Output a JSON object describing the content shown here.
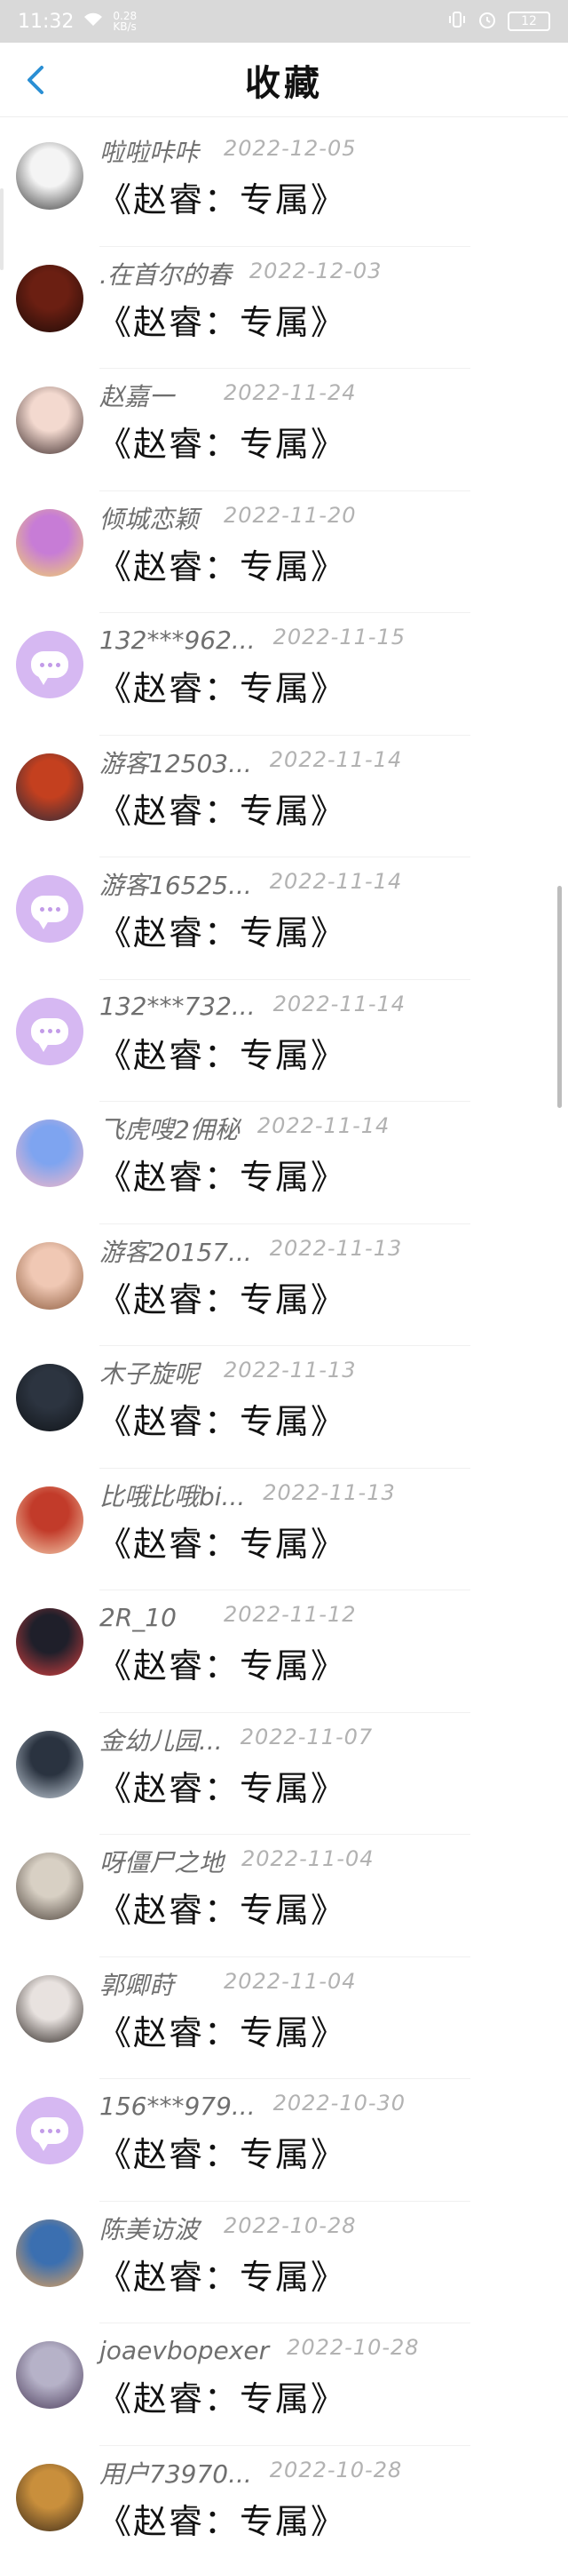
{
  "status_bar": {
    "time": "11:32",
    "network": "0.28 KB/s",
    "battery": "12"
  },
  "header": {
    "title": "收藏"
  },
  "items": [
    {
      "name": "啦啦咔咔",
      "date": "2022-12-05",
      "title": "《赵睿：专属》",
      "avatar": "photo-dog"
    },
    {
      "name": ".在首尔的春",
      "date": "2022-12-03",
      "title": "《赵睿：专属》",
      "avatar": "photo-dark"
    },
    {
      "name": "赵嘉一",
      "date": "2022-11-24",
      "title": "《赵睿：专属》",
      "avatar": "photo-woman"
    },
    {
      "name": "倾城恋颖",
      "date": "2022-11-20",
      "title": "《赵睿：专属》",
      "avatar": "photo-anime"
    },
    {
      "name": "132***962...",
      "date": "2022-11-15",
      "title": "《赵睿：专属》",
      "avatar": "default"
    },
    {
      "name": "游客12503...",
      "date": "2022-11-14",
      "title": "《赵睿：专属》",
      "avatar": "photo-car"
    },
    {
      "name": "游客16525...",
      "date": "2022-11-14",
      "title": "《赵睿：专属》",
      "avatar": "default"
    },
    {
      "name": "132***732...",
      "date": "2022-11-14",
      "title": "《赵睿：专属》",
      "avatar": "default"
    },
    {
      "name": "飞虎嗖2佣秘",
      "date": "2022-11-14",
      "title": "《赵睿：专属》",
      "avatar": "photo-cartoon"
    },
    {
      "name": "游客20157...",
      "date": "2022-11-13",
      "title": "《赵睿：专属》",
      "avatar": "photo-girl"
    },
    {
      "name": "木子旋呢",
      "date": "2022-11-13",
      "title": "《赵睿：专属》",
      "avatar": "photo-car-dark"
    },
    {
      "name": "比哦比哦bi...",
      "date": "2022-11-13",
      "title": "《赵睿：专属》",
      "avatar": "photo-red"
    },
    {
      "name": "2R_10",
      "date": "2022-11-12",
      "title": "《赵睿：专属》",
      "avatar": "photo-player"
    },
    {
      "name": "金幼儿园...",
      "date": "2022-11-07",
      "title": "《赵睿：专属》",
      "avatar": "photo-man"
    },
    {
      "name": "呀僵尸之地",
      "date": "2022-11-04",
      "title": "《赵睿：专属》",
      "avatar": "photo-room"
    },
    {
      "name": "郭卿莳",
      "date": "2022-11-04",
      "title": "《赵睿：专属》",
      "avatar": "photo-girl2"
    },
    {
      "name": "156***979...",
      "date": "2022-10-30",
      "title": "《赵睿：专属》",
      "avatar": "default"
    },
    {
      "name": "陈美访波",
      "date": "2022-10-28",
      "title": "《赵睿：专属》",
      "avatar": "photo-shiba"
    },
    {
      "name": "joaevbopexer",
      "date": "2022-10-28",
      "title": "《赵睿：专属》",
      "avatar": "photo-castle"
    },
    {
      "name": "用户73970...",
      "date": "2022-10-28",
      "title": "《赵睿：专属》",
      "avatar": "photo-brown"
    }
  ],
  "avatar_colors": {
    "photo-dog": [
      "#f4f4f4",
      "#3a3a3a"
    ],
    "photo-dark": [
      "#6b1f12",
      "#1d0b08"
    ],
    "photo-woman": [
      "#f3d9cf",
      "#3b2a2a"
    ],
    "photo-anime": [
      "#c77cd6",
      "#f2d36b"
    ],
    "photo-car": [
      "#c4401f",
      "#2a2a3a"
    ],
    "photo-cartoon": [
      "#7ea4f0",
      "#f7b8c7"
    ],
    "photo-girl": [
      "#f0c8b4",
      "#8b5a3c"
    ],
    "photo-car-dark": [
      "#2c3440",
      "#101418"
    ],
    "photo-red": [
      "#c23b2a",
      "#f4d0b0"
    ],
    "photo-player": [
      "#1f1f2a",
      "#d94040"
    ],
    "photo-man": [
      "#2a3340",
      "#c9d3de"
    ],
    "photo-room": [
      "#d8d0c4",
      "#4a4038"
    ],
    "photo-girl2": [
      "#e8e2df",
      "#2b2420"
    ],
    "photo-shiba": [
      "#3b6fb0",
      "#e3a25a"
    ],
    "photo-castle": [
      "#b6b2c8",
      "#4b3c5a"
    ],
    "photo-brown": [
      "#c98f3c",
      "#3a2a1a"
    ]
  },
  "date_offsets": {
    "short": 50,
    "long": 86
  },
  "scroll": {
    "position": 0.35
  }
}
